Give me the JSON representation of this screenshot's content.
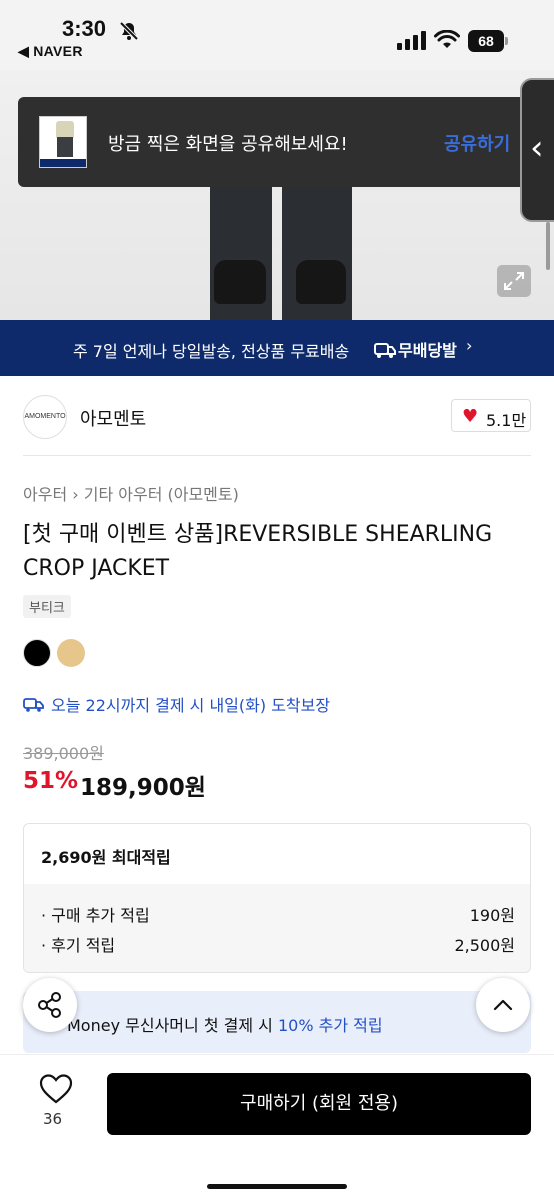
{
  "status_bar": {
    "time": "3:30",
    "back_app": "◀ NAVER",
    "battery": "68"
  },
  "share_toast": {
    "message": "방금 찍은 화면을 공유해보세요!",
    "action": "공유하기"
  },
  "banner": {
    "text": "주 7일 언제나 당일발송, 전상품 무료배송",
    "logo_text": "무배당발",
    "chevron": "›"
  },
  "brand": {
    "logo_text": "AMOMENTO",
    "name": "아모멘토",
    "likes": "5.1만"
  },
  "product": {
    "category": "아우터 › 기타 아우터 (아모멘토)",
    "title": "[첫 구매 이벤트 상품]REVERSIBLE SHEARLING CROP JACKET",
    "tag": "부티크",
    "colors": [
      "#000000",
      "#e6c68a"
    ],
    "delivery": "오늘 22시까지 결제 시 내일(화) 도착보장",
    "original_price": "389,000원",
    "discount": "51%",
    "price": "189,900원"
  },
  "points": {
    "title": "2,690원 최대적립",
    "rows": [
      {
        "label": "· 구매 추가 적립",
        "value": "190원"
      },
      {
        "label": "· 후기 적립",
        "value": "2,500원"
      }
    ]
  },
  "promo": {
    "prefix": "Money 무신사머니 첫 결제 시 ",
    "highlight": "10% 추가 적립"
  },
  "bottom": {
    "wish_count": "36",
    "buy_label": "구매하기 (회원 전용)"
  }
}
